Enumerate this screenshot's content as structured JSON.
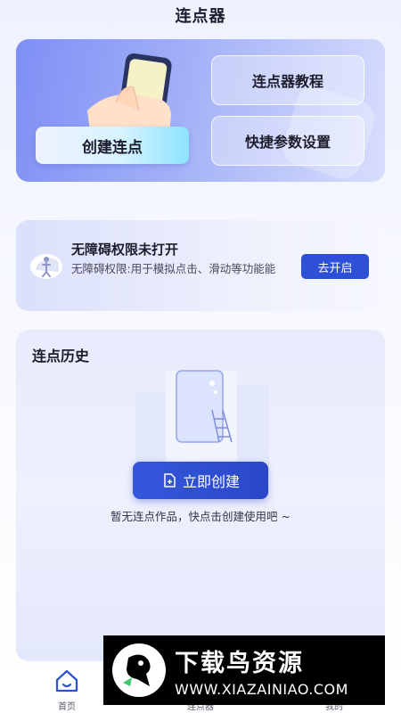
{
  "header": {
    "title": "连点器"
  },
  "hero": {
    "create_label": "创建连点",
    "tutorial_label": "连点器教程",
    "settings_label": "快捷参数设置"
  },
  "permission": {
    "title": "无障碍权限未打开",
    "description": "无障碍权限:用于模拟点击、滑动等功能能",
    "button_label": "去开启"
  },
  "history": {
    "title": "连点历史",
    "create_now_label": "立即创建",
    "empty_text": "暂无连点作品，快点击创建使用吧 ~"
  },
  "tabbar": {
    "items": [
      {
        "label": "首页",
        "icon": "home-icon",
        "active": true
      },
      {
        "label": "连点器",
        "icon": "clicker-icon",
        "active": false
      },
      {
        "label": "我的",
        "icon": "user-icon",
        "active": false
      }
    ]
  },
  "watermark": {
    "title": "下载鸟资源",
    "url": "WWW.XIAZAINIAO.COM"
  },
  "colors": {
    "accent": "#2d50d6",
    "hero_start": "#7e8ff5",
    "card_bg": "#e8ebfc"
  }
}
